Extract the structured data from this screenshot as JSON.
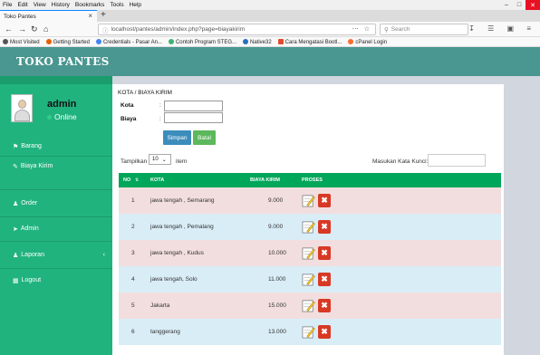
{
  "browser": {
    "menu": [
      "File",
      "Edit",
      "View",
      "History",
      "Bookmarks",
      "Tools",
      "Help"
    ],
    "tab_title": "Toko Pantes",
    "url": "localhost/pantes/admin/index.php?page=biayakirim",
    "search_placeholder": "Search",
    "bookmarks": [
      {
        "label": "Most Visited",
        "icon": "gear-icon",
        "color": "#555555"
      },
      {
        "label": "Getting Started",
        "icon": "firefox-icon",
        "color": "#e66000"
      },
      {
        "label": "Credentials - Pasar An...",
        "icon": "google-icon",
        "color": "#4285f4"
      },
      {
        "label": "Contoh Program STEG...",
        "icon": "globe-icon",
        "color": "#3cb371"
      },
      {
        "label": "Native32",
        "icon": "globe-icon",
        "color": "#2a6ebb"
      },
      {
        "label": "Cara Mengatasi Bootl...",
        "icon": "blogger-icon",
        "color": "#e04a2f"
      },
      {
        "label": "cPanel Login",
        "icon": "cpanel-icon",
        "color": "#ff6c2c"
      }
    ]
  },
  "header": {
    "logo": "TOKO PANTES"
  },
  "sidebar": {
    "user": {
      "name": "admin",
      "status": "Online"
    },
    "items": [
      {
        "label": "Barang",
        "icon": "tags-icon"
      },
      {
        "label": "Biaya Kirim",
        "icon": "edit-icon"
      },
      {
        "label": "Order",
        "icon": "users-icon"
      },
      {
        "label": "Admin",
        "icon": "wrench-icon"
      },
      {
        "label": "Laporan",
        "icon": "users-icon"
      },
      {
        "label": "Logout",
        "icon": "table-icon"
      }
    ]
  },
  "form": {
    "title": "KOTA / BIAYA KIRIM",
    "kota_label": "Kota",
    "biaya_label": "Biaya",
    "colon": ":",
    "kota_value": "",
    "biaya_value": "",
    "save_label": "Simpan",
    "cancel_label": "Batal"
  },
  "table_controls": {
    "show_label": "Tampilkan",
    "page_size": "10",
    "items_label": "item",
    "search_label": "Masukan Kata Kunci:",
    "search_value": ""
  },
  "table": {
    "columns": [
      "NO",
      "KOTA",
      "BIAYA KIRIM",
      "PROSES"
    ],
    "rows": [
      {
        "no": "1",
        "kota": "jawa tengah , Semarang",
        "biaya": "9.000"
      },
      {
        "no": "2",
        "kota": "jawa tengah , Pemalang",
        "biaya": "9.000"
      },
      {
        "no": "3",
        "kota": "jawa tengah , Kudus",
        "biaya": "10.000"
      },
      {
        "no": "4",
        "kota": "jawa tengah, Solo",
        "biaya": "11.000"
      },
      {
        "no": "5",
        "kota": "Jakarta",
        "biaya": "15.000"
      },
      {
        "no": "6",
        "kota": "tanggerang",
        "biaya": "13.000"
      }
    ]
  },
  "colors": {
    "header": "#4a9690",
    "sidebar": "#21b37e",
    "table_head": "#00a65a",
    "row_odd": "#f2dede",
    "row_even": "#d9edf7",
    "delete": "#d73925",
    "save": "#3c8dbc",
    "cancel": "#5cb85c"
  }
}
